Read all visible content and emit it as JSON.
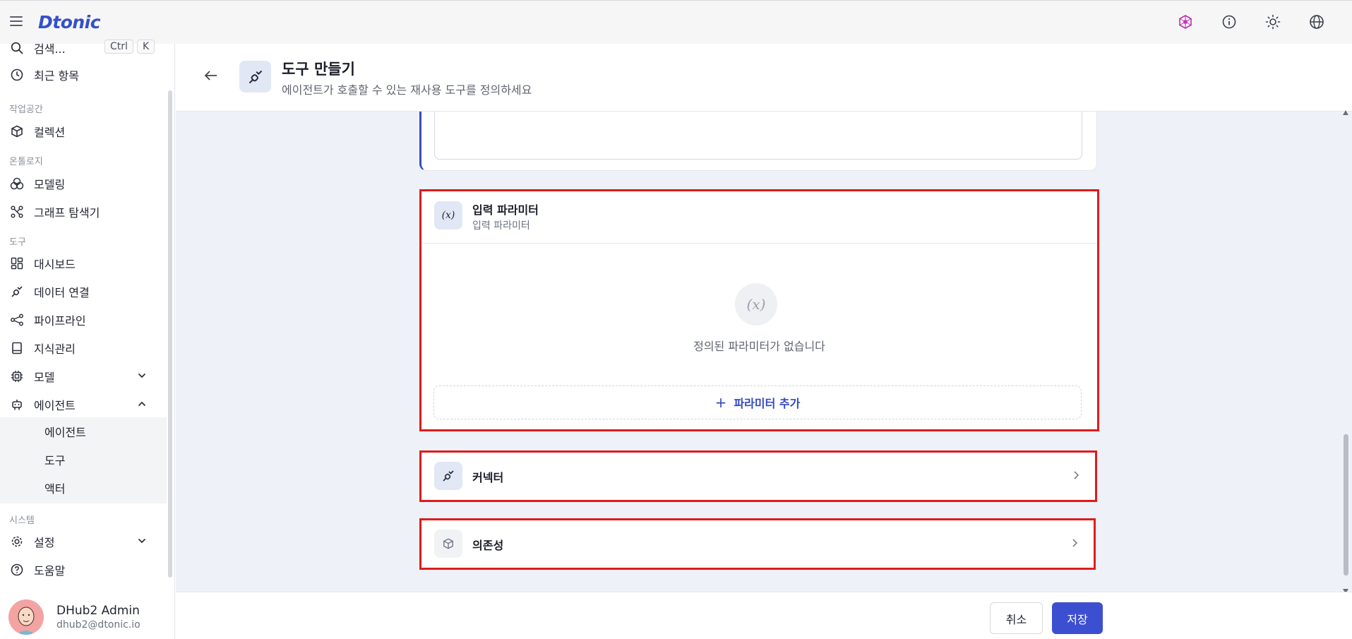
{
  "app": {
    "logo": "Dtonic"
  },
  "topbar": {
    "icons": [
      "brand-graph-icon",
      "info-icon",
      "sun-icon",
      "globe-icon"
    ]
  },
  "sidebar": {
    "search_label": "검색...",
    "search_kbd_1": "Ctrl",
    "search_kbd_2": "K",
    "recent": "최근 항목",
    "sections": {
      "workspace": "작업공간",
      "ontology": "온톨로지",
      "tools": "도구",
      "system": "시스템"
    },
    "items": {
      "collection": "컬렉션",
      "modeling": "모델링",
      "graph_explorer": "그래프 탐색기",
      "dashboard": "대시보드",
      "data_connection": "데이터 연결",
      "pipeline": "파이프라인",
      "knowledge": "지식관리",
      "model": "모델",
      "agent": "에이전트",
      "settings": "설정",
      "help": "도움말"
    },
    "agent_sub": [
      "에이전트",
      "도구",
      "액터"
    ]
  },
  "profile": {
    "name": "DHub2 Admin",
    "email": "dhub2@dtonic.io"
  },
  "header": {
    "title": "도구 만들기",
    "subtitle": "에이전트가 호출할 수 있는 재사용 도구를 정의하세요"
  },
  "params_card": {
    "icon_text": "(x)",
    "title": "입력 파라미터",
    "subtitle": "입력 파라미터",
    "empty_icon": "(x)",
    "empty_text": "정의된 파라미터가 없습니다",
    "add_plus": "+",
    "add_label": "파라미터 추가"
  },
  "connector_card": {
    "title": "커넥터"
  },
  "dependency_card": {
    "title": "의존성"
  },
  "footer": {
    "cancel": "취소",
    "save": "저장"
  },
  "colors": {
    "accent": "#3d4fd1",
    "highlight": "#e01b1b",
    "brand": "#3550c8"
  }
}
